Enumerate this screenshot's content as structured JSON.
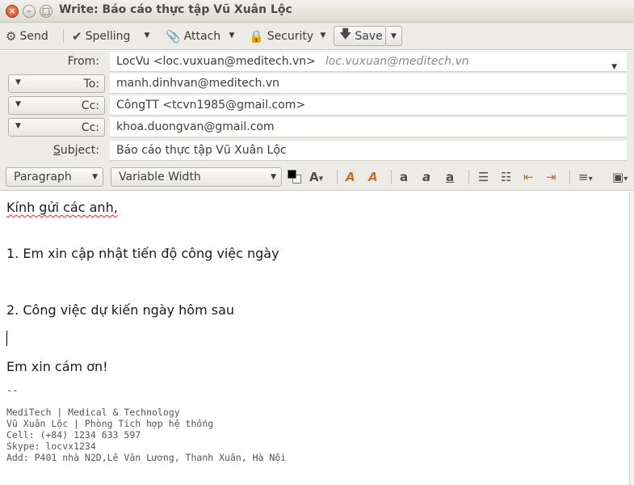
{
  "window": {
    "title": "Write: Báo cáo thực tập Vũ Xuân Lộc",
    "close_glyph": "×",
    "min_glyph": "–",
    "max_glyph": "□"
  },
  "toolbar": {
    "send_label": "Send",
    "spelling_label": "Spelling",
    "attach_label": "Attach",
    "security_label": "Security",
    "save_label": "Save",
    "dropdown_glyph": "▼"
  },
  "header": {
    "from_label": "From:",
    "from_value": "LocVu <loc.vuxuan@meditech.vn>",
    "from_alt": "loc.vuxuan@meditech.vn",
    "recipients": [
      {
        "type": "To:",
        "value": "manh.dinhvan@meditech.vn"
      },
      {
        "type": "Cc:",
        "value": "CôngTT <tcvn1985@gmail.com>"
      },
      {
        "type": "Cc:",
        "value": "khoa.duongvan@gmail.com"
      }
    ],
    "subject_label_first": "S",
    "subject_label_rest": "ubject:",
    "subject_value": "Báo cáo thực tập Vũ Xuân Lộc"
  },
  "format_toolbar": {
    "paragraph_format": "Paragraph",
    "font_family": "Variable Width"
  },
  "body": {
    "greeting": "Kính gửi các anh,",
    "item1": "1. Em xin cập nhật tiến độ công việc ngày",
    "item2": "2. Công việc dự kiến ngày hôm sau",
    "closing": "Em xin cám ơn!",
    "sig_separator": "--",
    "signature": [
      "MediTech | Medical & Technology",
      "Vũ Xuân Lộc | Phòng Tích hợp hệ thống",
      "Cell: (+84) 1234 633 597",
      "Skype: locvx1234",
      "Add: P401 nhà N2D,Lê Văn Lương, Thanh Xuân, Hà Nội"
    ]
  }
}
